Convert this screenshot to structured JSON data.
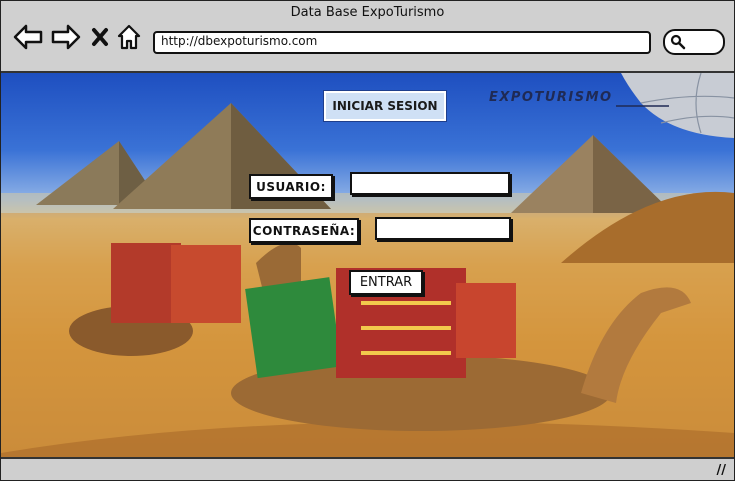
{
  "window": {
    "title": "Data Base ExpoTurismo"
  },
  "toolbar": {
    "back_icon": "arrow-left-icon",
    "forward_icon": "arrow-right-icon",
    "close_icon": "x-icon",
    "home_icon": "home-icon",
    "url": "http://dbexpoturismo.com",
    "search_icon": "search-icon"
  },
  "page": {
    "heading": "INICIAR SESION",
    "brand": "EXPOTURISMO",
    "usuario_label": "USUARIO:",
    "usuario_value": "",
    "password_label": "CONTRASEÑA:",
    "password_value": "",
    "submit_label": "ENTRAR"
  },
  "colors": {
    "sky_top": "#1e4fc0",
    "sand": "#cf8f34",
    "chrome": "#d0d0d0"
  }
}
